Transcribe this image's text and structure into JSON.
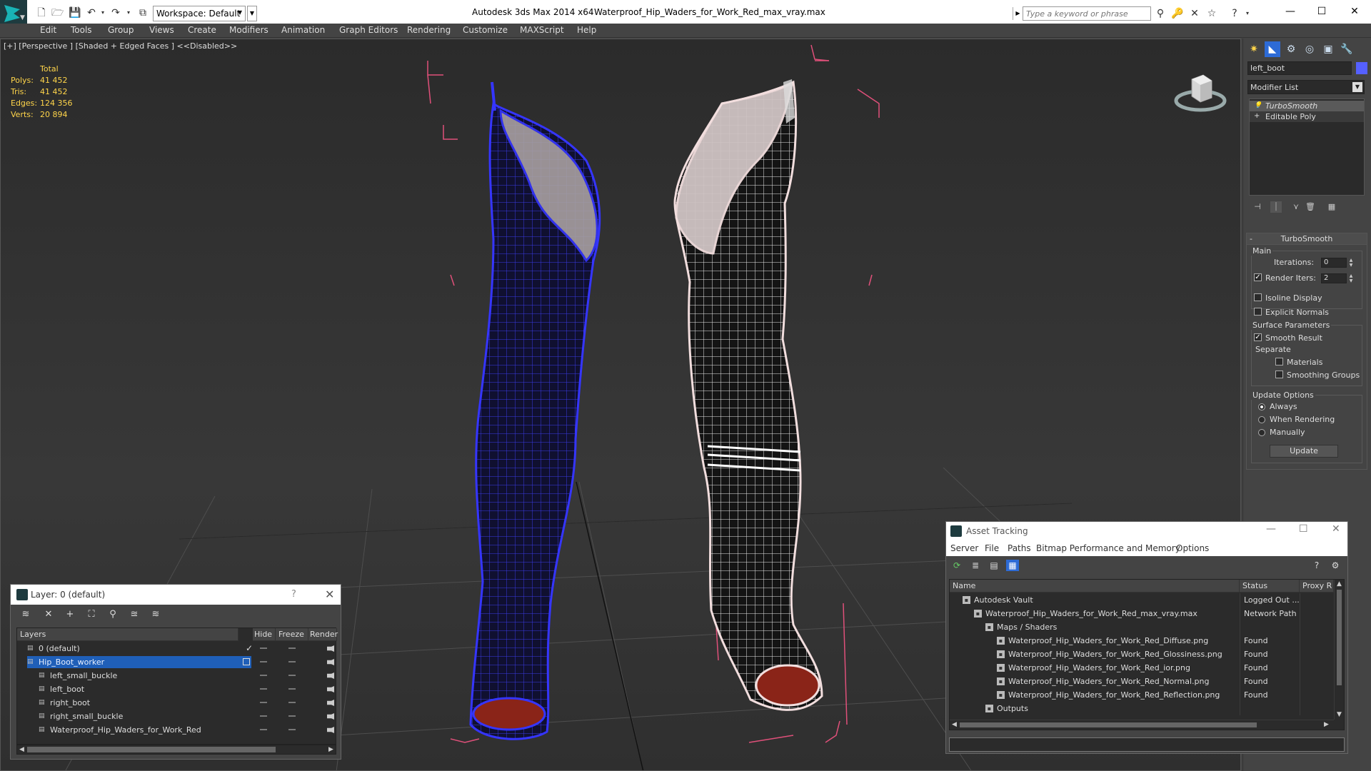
{
  "titlebar": {
    "app": "Autodesk 3ds Max  2014 x64",
    "document": "Waterproof_Hip_Waders_for_Work_Red_max_vray.max",
    "workspace": "Workspace: Default",
    "search_placeholder": "Type a keyword or phrase"
  },
  "menu": [
    "Edit",
    "Tools",
    "Group",
    "Views",
    "Create",
    "Modifiers",
    "Animation",
    "Graph Editors",
    "Rendering",
    "Customize",
    "MAXScript",
    "Help"
  ],
  "viewport": {
    "label": "[+] [Perspective ] [Shaded + Edged Faces ]  <<Disabled>>",
    "stats": {
      "header": "Total",
      "rows": [
        {
          "label": "Polys:",
          "value": "41 452"
        },
        {
          "label": "Tris:",
          "value": "41 452"
        },
        {
          "label": "Edges:",
          "value": "124 356"
        },
        {
          "label": "Verts:",
          "value": "20 894"
        }
      ]
    }
  },
  "command_panel": {
    "object_name": "left_boot",
    "object_color": "#5560ff",
    "modifier_list": "Modifier List",
    "stack": [
      "TurboSmooth",
      "Editable Poly"
    ],
    "rollout_title": "TurboSmooth",
    "main_group": "Main",
    "iterations_label": "Iterations:",
    "iterations_value": "0",
    "render_iters_label": "Render Iters:",
    "render_iters_value": "2",
    "isoline": "Isoline Display",
    "explicit_normals": "Explicit Normals",
    "surface_params": "Surface Parameters",
    "smooth_result": "Smooth Result",
    "separate": "Separate",
    "materials": "Materials",
    "smoothing_groups": "Smoothing Groups",
    "update_options": "Update Options",
    "always": "Always",
    "when_rendering": "When Rendering",
    "manually": "Manually",
    "update_button": "Update"
  },
  "layer_explorer": {
    "title": "Layer: 0 (default)",
    "help": "?",
    "columns": [
      "Layers",
      "Hide",
      "Freeze",
      "Render"
    ],
    "rows": [
      {
        "name": "0 (default)",
        "indent": 1,
        "selected": false,
        "mark": "check"
      },
      {
        "name": "Hip_Boot_worker",
        "indent": 1,
        "selected": true,
        "mark": "box"
      },
      {
        "name": "left_small_buckle",
        "indent": 2,
        "selected": false,
        "mark": ""
      },
      {
        "name": "left_boot",
        "indent": 2,
        "selected": false,
        "mark": ""
      },
      {
        "name": "right_boot",
        "indent": 2,
        "selected": false,
        "mark": ""
      },
      {
        "name": "right_small_buckle",
        "indent": 2,
        "selected": false,
        "mark": ""
      },
      {
        "name": "Waterproof_Hip_Waders_for_Work_Red",
        "indent": 2,
        "selected": false,
        "mark": ""
      }
    ]
  },
  "asset_tracking": {
    "title": "Asset Tracking",
    "menu": [
      "Server",
      "File",
      "Paths",
      "Bitmap Performance and Memory",
      "Options"
    ],
    "columns": [
      "Name",
      "Status",
      "Proxy R"
    ],
    "rows": [
      {
        "name": "Autodesk Vault",
        "status": "Logged Out ...",
        "indent": 1
      },
      {
        "name": "Waterproof_Hip_Waders_for_Work_Red_max_vray.max",
        "status": "Network Path",
        "indent": 2
      },
      {
        "name": "Maps / Shaders",
        "status": "",
        "indent": 3
      },
      {
        "name": "Waterproof_Hip_Waders_for_Work_Red_Diffuse.png",
        "status": "Found",
        "indent": 4
      },
      {
        "name": "Waterproof_Hip_Waders_for_Work_Red_Glossiness.png",
        "status": "Found",
        "indent": 4
      },
      {
        "name": "Waterproof_Hip_Waders_for_Work_Red_ior.png",
        "status": "Found",
        "indent": 4
      },
      {
        "name": "Waterproof_Hip_Waders_for_Work_Red_Normal.png",
        "status": "Found",
        "indent": 4
      },
      {
        "name": "Waterproof_Hip_Waders_for_Work_Red_Reflection.png",
        "status": "Found",
        "indent": 4
      },
      {
        "name": "Outputs",
        "status": "",
        "indent": 3
      }
    ]
  },
  "colors": {
    "accent_selection": "#1f5fb8",
    "stats_text": "#ffd54a",
    "left_boot_wire": "#3030e0",
    "right_boot_wire": "#ffffff",
    "bounding_box": "#e0507a",
    "sole": "#8a2418"
  }
}
